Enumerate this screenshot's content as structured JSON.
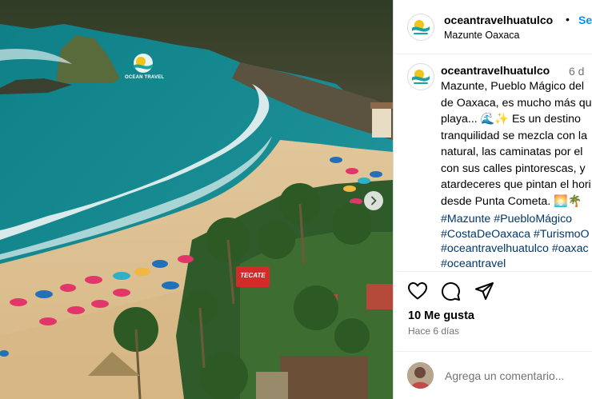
{
  "post": {
    "account": "oceantravelhuatulco",
    "follow_label": "Seguir",
    "location": "Mazunte Oaxaca",
    "caption_time": "6 d",
    "caption": "Mazunte, Pueblo Mágico del\nde Oaxaca, es mucho más que\nplaya... 🌊✨ Es un destino\ntranquilidad se mezcla con la\nnatural, las caminatas por el\ncon sus calles pintorescas, y\natardeceres que pintan el hori\ndesde Punta Cometa. 🌅🌴",
    "hashtags": "#Mazunte #PuebloMágico\n#CostaDeOaxaca #TurismoO\n#oceantravelhuatulco #oaxac\n#oceantravel",
    "likes": "10 Me gusta",
    "posted": "Hace 6 días",
    "comment_placeholder": "Agrega un comentario..."
  },
  "photo": {
    "watermark_text": "OCEAN TRAVEL",
    "sign_text": "TECATE"
  },
  "icons": {
    "like": "heart-icon",
    "comment": "speech-bubble-icon",
    "share": "paper-plane-icon",
    "next": "chevron-right-icon"
  },
  "colors": {
    "link_blue": "#0095f6",
    "hashtag_blue": "#00376b",
    "muted": "#737373",
    "brand_teal": "#1aa3a0",
    "brand_yellow": "#f2c318"
  }
}
